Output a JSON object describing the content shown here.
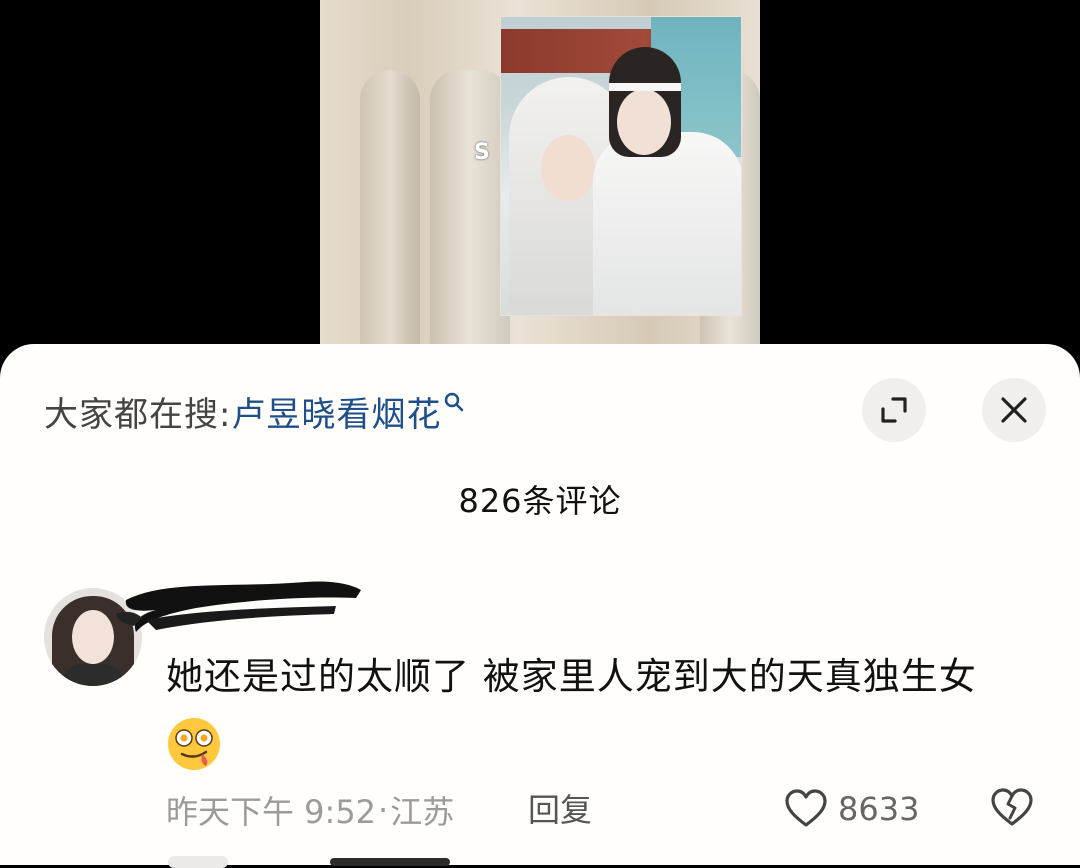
{
  "video": {
    "watermark_glyph": "S"
  },
  "sheet": {
    "search_prefix": "大家都在搜: ",
    "search_term": "卢昱晓看烟花",
    "comment_count": "826条评论",
    "icons": {
      "search": "search-icon",
      "expand": "expand-icon",
      "close": "close-icon",
      "like": "heart-icon",
      "dislike": "broken-heart-icon"
    }
  },
  "comment": {
    "text": "她还是过的太顺了 被家里人宠到大的天真独生女",
    "emoji": "drooling-face-emoji",
    "time": "昨天下午 9:52",
    "separator": "·",
    "location": "江苏",
    "reply_label": "回复",
    "like_count": "8633"
  },
  "colors": {
    "sheet_bg": "#fffefb",
    "search_term": "#1f4f8a",
    "meta_text": "#9b9b9b"
  }
}
